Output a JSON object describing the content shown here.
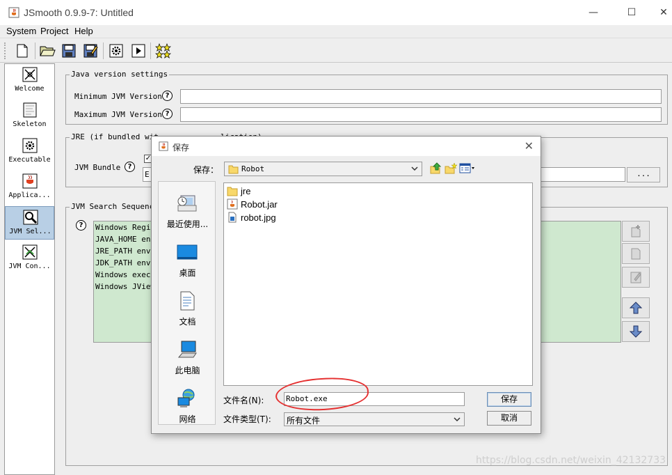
{
  "window": {
    "title": "JSmooth 0.9.9-7: Untitled",
    "controls": {
      "minimize": "—",
      "maximize": "☐",
      "close": "✕"
    }
  },
  "menu": [
    "System",
    "Project",
    "Help"
  ],
  "toolbar": {
    "buttons": [
      "new-icon",
      "open-icon",
      "save-icon",
      "save-as-icon",
      "compile-icon",
      "run-icon",
      "about-icon"
    ]
  },
  "sidebar": {
    "items": [
      {
        "label": "Welcome",
        "icon": "welcome-icon",
        "selected": false
      },
      {
        "label": "Skeleton",
        "icon": "skeleton-icon",
        "selected": false
      },
      {
        "label": "Executable",
        "icon": "executable-icon",
        "selected": false
      },
      {
        "label": "Applica...",
        "icon": "application-icon",
        "selected": false
      },
      {
        "label": "JVM Sel...",
        "icon": "jvm-select-icon",
        "selected": true
      },
      {
        "label": "JVM Con...",
        "icon": "jvm-config-icon",
        "selected": false
      }
    ]
  },
  "java_version": {
    "title": "Java version settings",
    "min_label": "Minimum JVM Version",
    "min_value": "",
    "max_label": "Maximum JVM Version",
    "max_value": ""
  },
  "jre": {
    "title": "JRE (if bundled wit",
    "title_tail": "lication)",
    "bundle_label": "JVM Bundle",
    "path_value": "E:",
    "browse_label": "..."
  },
  "jvm_search": {
    "title": "JVM Search Sequence",
    "items": [
      "Windows Regist",
      "JAVA_HOME envi",
      "JRE_PATH envir",
      "JDK_PATH envir",
      "Windows execut",
      "Windows JView"
    ]
  },
  "dialog": {
    "title": "保存",
    "save_in_label": "保存：",
    "save_in_value": "Robot",
    "places": [
      {
        "label": "最近使用...",
        "icon": "recent-icon"
      },
      {
        "label": "桌面",
        "icon": "desktop-icon"
      },
      {
        "label": "文档",
        "icon": "documents-icon"
      },
      {
        "label": "此电脑",
        "icon": "computer-icon"
      },
      {
        "label": "网络",
        "icon": "network-icon"
      }
    ],
    "files": [
      {
        "name": "jre",
        "icon": "folder-icon"
      },
      {
        "name": "Robot.jar",
        "icon": "jar-file-icon"
      },
      {
        "name": "robot.jpg",
        "icon": "image-file-icon"
      }
    ],
    "filename_label": "文件名(N):",
    "filename_value": "Robot.exe",
    "filetype_label": "文件类型(T):",
    "filetype_value": "所有文件",
    "save_button": "保存",
    "cancel_button": "取消"
  },
  "watermark": "https://blog.csdn.net/weixin_42132733",
  "colors": {
    "selection": "#b8cfe5",
    "list_bg": "#cfe8cf",
    "annotation": "#e53030"
  }
}
